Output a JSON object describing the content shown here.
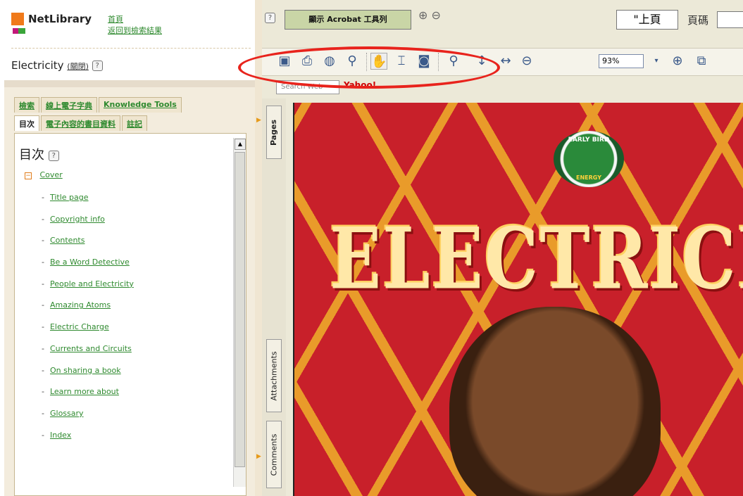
{
  "left_header": {
    "brand": "NetLibrary",
    "home_link": "首頁",
    "back_link": "返回到檢索結果",
    "book_title": "Electricity",
    "close_label": "(關閉)"
  },
  "tabs_row1": [
    "檢索",
    "線上電子字典",
    "Knowledge Tools"
  ],
  "tabs_row2": [
    "目次",
    "電子內容的書目資料",
    "註記"
  ],
  "toc": {
    "title": "目次",
    "cover": "Cover",
    "items": [
      "Title page",
      "Copyright info",
      "Contents",
      "Be a Word Detective",
      "People and Electricity",
      "Amazing Atoms",
      "Electric Charge",
      "Currents and Circuits",
      "On sharing a book",
      "Learn more about",
      "Glossary",
      "Index"
    ]
  },
  "toolbar": {
    "acrobat_label": "顯示 Acrobat 工具列",
    "prev_page": "\"上頁",
    "page_label": "頁碼",
    "zoom_value": "93%",
    "search_placeholder": "Search Web",
    "yahoo": "Yahoo!"
  },
  "side_tabs": [
    "Pages",
    "Attachments",
    "Comments"
  ],
  "cover": {
    "title": "ELECTRICIT",
    "badge_top": "EARLY BIRD",
    "badge_bottom": "ENERGY"
  },
  "colors": {
    "link_green": "#2f8a2f",
    "panel_tan": "#f3ecdd",
    "cover_red": "#c8202a",
    "highlight_oval": "#e8231c"
  }
}
